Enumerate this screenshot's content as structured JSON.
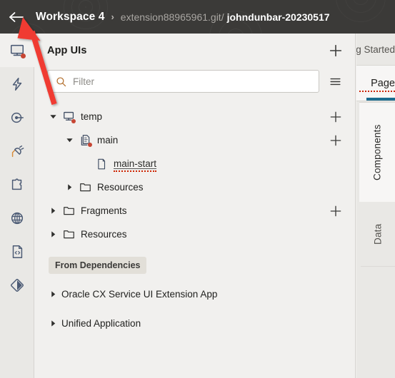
{
  "header": {
    "back_icon": "arrow-left-icon",
    "workspace": "Workspace 4",
    "separator": "›",
    "repo_path": "extension88965961.git/",
    "branch": "johndunbar-20230517"
  },
  "rail": {
    "items": [
      {
        "name": "app-uis",
        "icon": "monitor-icon",
        "active": true,
        "badge": true
      },
      {
        "name": "actions",
        "icon": "lightning-bolt-icon",
        "active": false,
        "badge": false
      },
      {
        "name": "events",
        "icon": "target-icon",
        "active": false,
        "badge": false
      },
      {
        "name": "connections",
        "icon": "plug-icon",
        "active": false,
        "badge": false
      },
      {
        "name": "extensions",
        "icon": "puzzle-piece-icon",
        "active": false,
        "badge": false
      },
      {
        "name": "translations",
        "icon": "globe-icon",
        "active": false,
        "badge": false
      },
      {
        "name": "source",
        "icon": "code-file-icon",
        "active": false,
        "badge": false
      },
      {
        "name": "git",
        "icon": "git-diamond-icon",
        "active": false,
        "badge": false
      }
    ]
  },
  "panel": {
    "title": "App UIs",
    "add_icon": "plus-icon",
    "menu_icon": "hamburger-menu-icon",
    "filter": {
      "placeholder": "Filter",
      "value": "",
      "icon": "search-icon"
    },
    "tree": [
      {
        "label": "temp",
        "icon": "monitor-icon",
        "indent": 0,
        "twisty": "expanded",
        "badge": true,
        "has_add": true,
        "underline": false,
        "spellcheck": false
      },
      {
        "label": "main",
        "icon": "page-flow-icon",
        "indent": 1,
        "twisty": "expanded",
        "badge": true,
        "has_add": true,
        "underline": false,
        "spellcheck": false
      },
      {
        "label": "main-start",
        "icon": "document-icon",
        "indent": 2,
        "twisty": "none",
        "badge": false,
        "has_add": false,
        "underline": true,
        "spellcheck": true
      },
      {
        "label": "Resources",
        "icon": "folder-icon",
        "indent": 1,
        "twisty": "collapsed",
        "badge": false,
        "has_add": false,
        "underline": false,
        "spellcheck": false
      },
      {
        "label": "Fragments",
        "icon": "folder-icon",
        "indent": 0,
        "twisty": "collapsed",
        "badge": false,
        "has_add": true,
        "underline": false,
        "spellcheck": false
      },
      {
        "label": "Resources",
        "icon": "folder-icon",
        "indent": 0,
        "twisty": "collapsed",
        "badge": false,
        "has_add": false,
        "underline": false,
        "spellcheck": false
      }
    ],
    "dependencies_badge": "From Dependencies",
    "dependencies": [
      {
        "label": "Oracle CX Service UI Extension App",
        "twisty": "collapsed"
      },
      {
        "label": "Unified Application",
        "twisty": "collapsed"
      }
    ]
  },
  "right_panel": {
    "top_tab": "Getting Started",
    "active_tab": "Page",
    "vertical_tabs": [
      "Components",
      "Data"
    ],
    "accent_color": "#1b6b8f"
  },
  "annotation": {
    "type": "arrow",
    "color": "#f03a30",
    "points_to": "back-arrow"
  },
  "colors": {
    "header_bg": "#3b3a38",
    "panel_bg": "#f1f0ee",
    "rail_bg": "#e9e8e5",
    "badge_red": "#c74634",
    "accent": "#1b6b8f"
  }
}
